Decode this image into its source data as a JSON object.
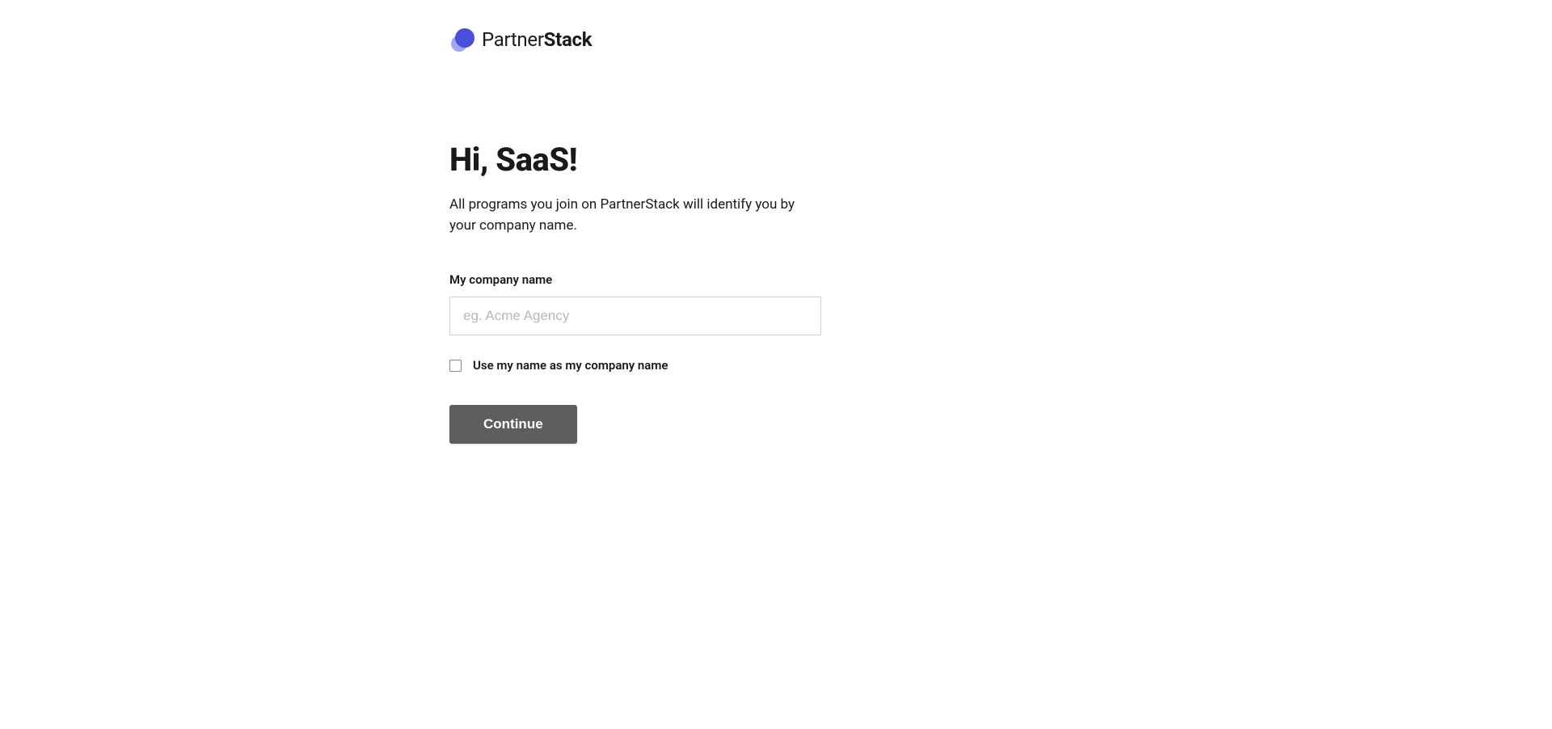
{
  "brand": {
    "name_light": "Partner",
    "name_bold": "Stack"
  },
  "heading": "Hi, SaaS!",
  "subtext": "All programs you join on PartnerStack will identify you by your company name.",
  "form": {
    "company_label": "My company name",
    "company_placeholder": "eg. Acme Agency",
    "company_value": "",
    "use_name_checkbox_label": "Use my name as my company name",
    "continue_button": "Continue"
  }
}
